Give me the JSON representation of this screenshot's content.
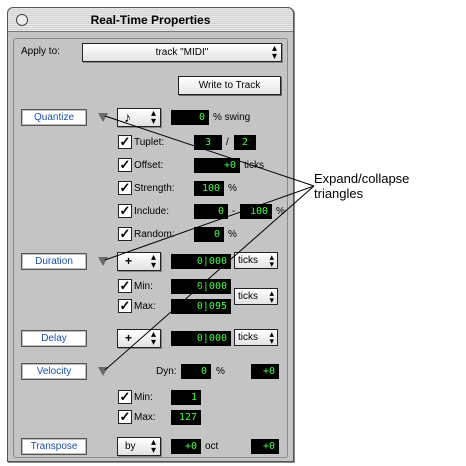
{
  "window": {
    "title": "Real-Time Properties"
  },
  "apply": {
    "label": "Apply to:",
    "value": "track \"MIDI\"",
    "write_button": "Write to Track"
  },
  "quantize": {
    "button": "Quantize",
    "note_glyph": "♪",
    "swing_value": "0",
    "swing_label": "% swing",
    "tuplet_label": "Tuplet:",
    "tuplet_a": "3",
    "tuplet_sep": "/",
    "tuplet_b": "2",
    "offset_label": "Offset:",
    "offset_value": "+0",
    "offset_unit": "ticks",
    "strength_label": "Strength:",
    "strength_value": "100",
    "strength_unit": "%",
    "include_label": "Include:",
    "include_a": "0",
    "include_sep": "-",
    "include_b": "100",
    "include_unit": "%",
    "random_label": "Random:",
    "random_value": "0",
    "random_unit": "%"
  },
  "duration": {
    "button": "Duration",
    "mode": "+",
    "value": "0|000",
    "unit": "ticks",
    "min_label": "Min:",
    "min_value": "0|000",
    "max_label": "Max:",
    "max_value": "0|095",
    "minmax_unit": "ticks"
  },
  "delay": {
    "button": "Delay",
    "mode": "+",
    "value": "0|000",
    "unit": "ticks"
  },
  "velocity": {
    "button": "Velocity",
    "dyn_label": "Dyn:",
    "dyn_value": "0",
    "dyn_unit": "%",
    "offset_value": "+0",
    "min_label": "Min:",
    "min_value": "1",
    "max_label": "Max:",
    "max_value": "127"
  },
  "transpose": {
    "button": "Transpose",
    "mode": "by",
    "value": "+0",
    "unit": "oct",
    "semis_value": "+0"
  },
  "annotation": {
    "line1": "Expand/collapse",
    "line2": "triangles"
  },
  "checkmark": "✓",
  "colors": {
    "window_bg": "#c4c4c4",
    "lcd_bg": "#000000",
    "lcd_text": "#3cff3c",
    "section_button_text": "#1a4fb4"
  }
}
